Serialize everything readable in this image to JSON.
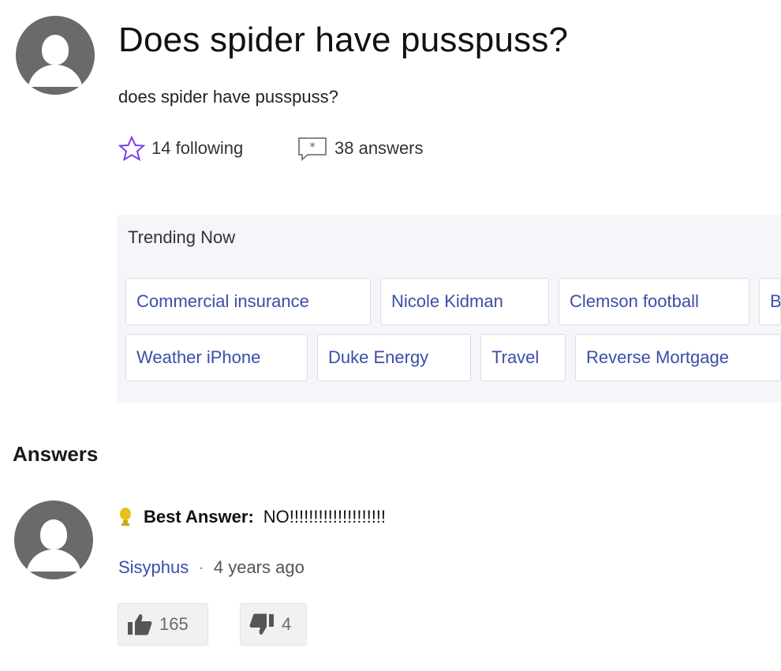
{
  "question": {
    "title": "Does spider have pusspuss?",
    "body": "does spider have pusspuss?",
    "following_label": "14 following",
    "answers_label": "38 answers"
  },
  "trending": {
    "title": "Trending Now",
    "chips": [
      "Commercial insurance",
      "Nicole Kidman",
      "Clemson football",
      "B",
      "Weather iPhone",
      "Duke Energy",
      "Travel",
      "Reverse Mortgage"
    ]
  },
  "answers": {
    "heading": "Answers",
    "best": {
      "label": "Best Answer:",
      "text": "NO!!!!!!!!!!!!!!!!!!!!",
      "author": "Sisyphus",
      "separator": "·",
      "time": "4 years ago",
      "upvotes": "165",
      "downvotes": "4"
    }
  },
  "colors": {
    "link": "#3c4da8",
    "star": "#7b3fe4",
    "trophy": "#e8c21c",
    "avatar": "#6a6a6a",
    "trending_bg": "#f6f6fa"
  },
  "icons": [
    "avatar-icon",
    "star-icon",
    "answer-icon",
    "trophy-icon",
    "thumbs-up-icon",
    "thumbs-down-icon"
  ]
}
